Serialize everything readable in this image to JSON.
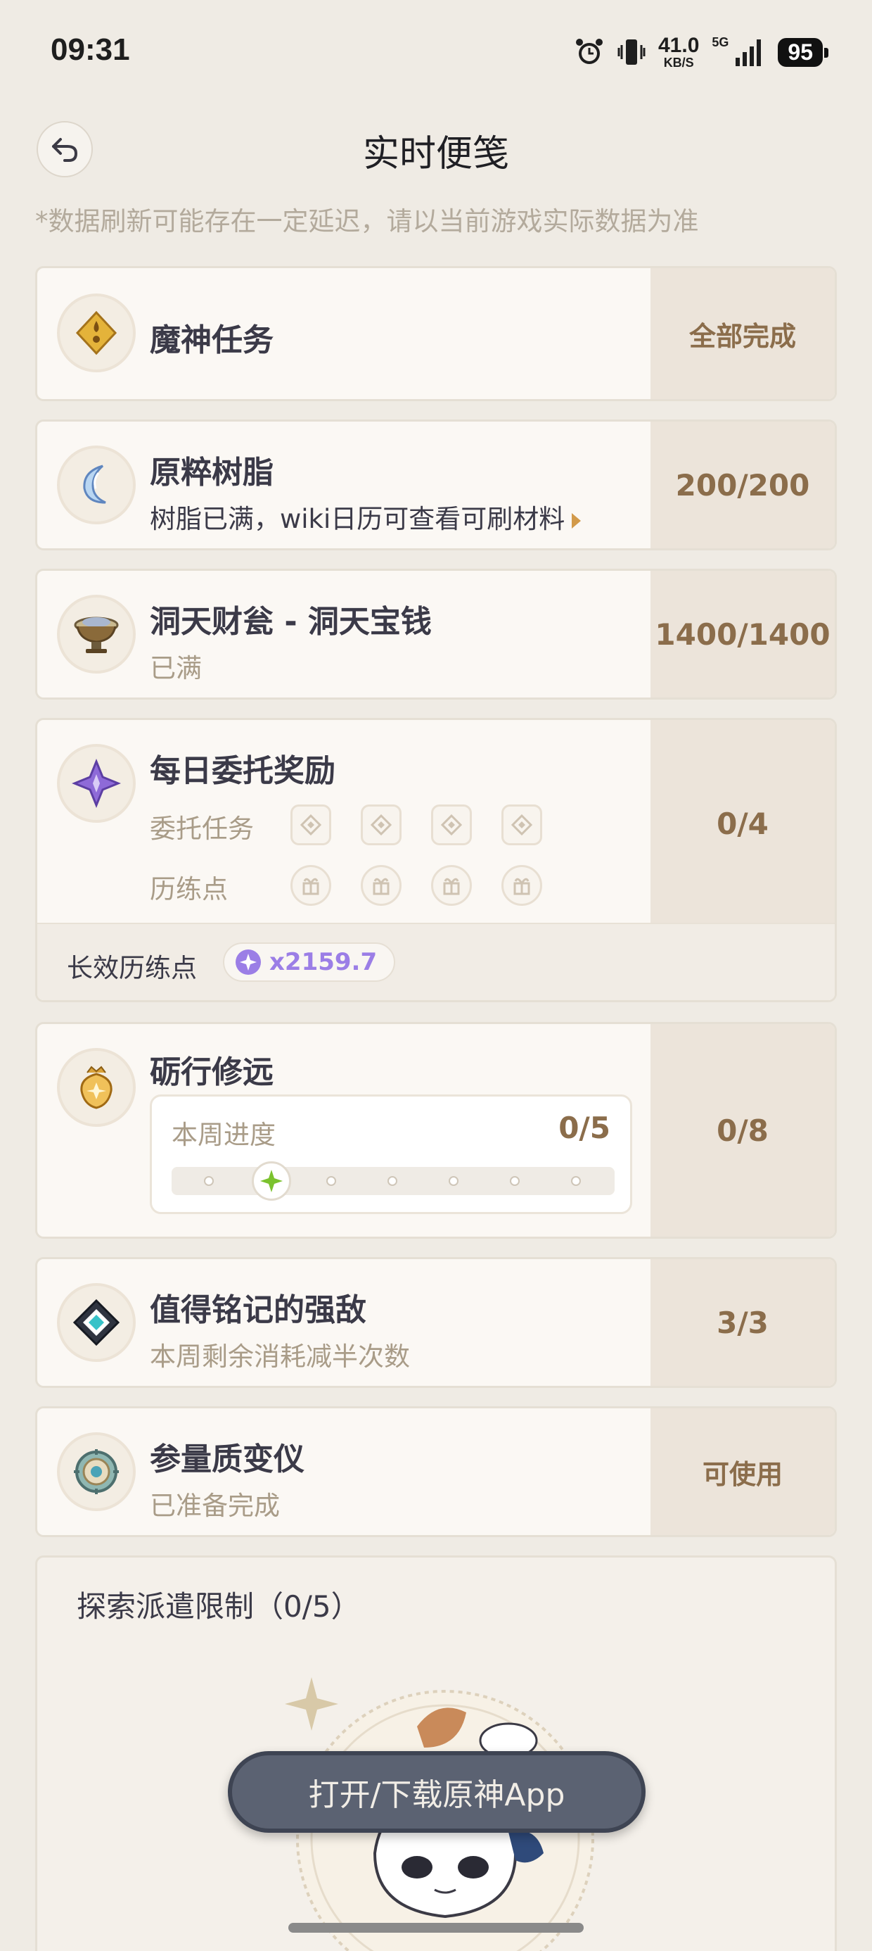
{
  "status_bar": {
    "time": "09:31",
    "net_speed": "41.0",
    "net_unit": "KB/S",
    "network": "5G",
    "battery": "95",
    "icons": [
      "alarm-icon",
      "vibrate-icon",
      "signal-icon"
    ]
  },
  "header": {
    "title": "实时便笺",
    "back_icon": "back-arrow-icon"
  },
  "notice": "*数据刷新可能存在一定延迟，请以当前游戏实际数据为准",
  "cards": {
    "archon_quest": {
      "title": "魔神任务",
      "value": "全部完成",
      "icon": "archon-quest-icon"
    },
    "resin": {
      "title": "原粹树脂",
      "subtitle": "树脂已满，wiki日历可查看可刷材料",
      "value": "200/200",
      "icon": "resin-icon"
    },
    "realm_currency": {
      "title": "洞天财瓮 - 洞天宝钱",
      "subtitle": "已满",
      "value": "1400/1400",
      "icon": "jar-icon"
    },
    "daily_commission": {
      "title": "每日委托奖励",
      "row1_label": "委托任务",
      "row2_label": "历练点",
      "value": "0/4",
      "footer_label": "长效历练点",
      "footer_value": "x2159.7",
      "icon": "commission-icon"
    },
    "weekly": {
      "title": "砺行修远",
      "progress_label": "本周进度",
      "progress_value": "0/5",
      "progress_fraction": 0.167,
      "value": "0/8",
      "icon": "weekly-icon"
    },
    "weekly_boss": {
      "title": "值得铭记的强敌",
      "subtitle": "本周剩余消耗减半次数",
      "value": "3/3",
      "icon": "boss-icon"
    },
    "transformer": {
      "title": "参量质变仪",
      "subtitle": "已准备完成",
      "value": "可使用",
      "icon": "transformer-icon"
    }
  },
  "expedition": {
    "title": "探索派遣限制（0/5）"
  },
  "float_button": "打开/下载原神App",
  "colors": {
    "accent_brown": "#8b6d4b",
    "muted": "#a99c88",
    "bg": "#efebe4",
    "purple": "#9b7ee6"
  }
}
